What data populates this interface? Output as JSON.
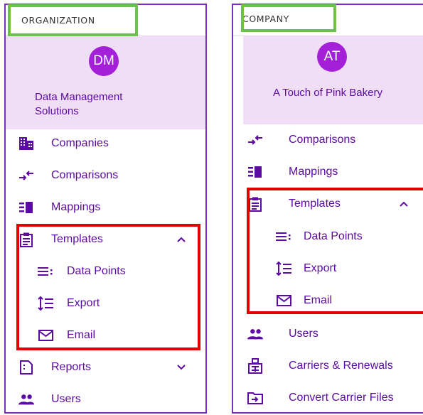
{
  "left_panel": {
    "section_label": "ORGANIZATION",
    "avatar_initials": "DM",
    "org_name": "Data Management Solutions",
    "menu": {
      "companies": "Companies",
      "comparisons": "Comparisons",
      "mappings": "Mappings",
      "templates": "Templates",
      "data_points": "Data Points",
      "export": "Export",
      "email": "Email",
      "reports": "Reports",
      "users": "Users"
    }
  },
  "right_panel": {
    "section_label": "COMPANY",
    "avatar_initials": "AT",
    "org_name": "A Touch of Pink Bakery",
    "menu": {
      "comparisons": "Comparisons",
      "mappings": "Mappings",
      "templates": "Templates",
      "data_points": "Data Points",
      "export": "Export",
      "email": "Email",
      "users": "Users",
      "carriers_renewals": "Carriers & Renewals",
      "convert_carrier_files": "Convert Carrier Files"
    }
  },
  "colors": {
    "brand_purple": "#5b0aa3",
    "avatar_bg": "#a320d8",
    "panel_border": "#7b2fc0",
    "org_box_bg": "#f0def7",
    "highlight_red": "#e00000",
    "highlight_green": "#6cc24a"
  },
  "icons": {
    "companies": "building-icon",
    "comparisons": "compare-arrows-icon",
    "mappings": "mapping-icon",
    "templates": "clipboard-icon",
    "data_points": "list-dots-icon",
    "export": "sort-export-icon",
    "email": "envelope-icon",
    "reports": "report-icon",
    "users": "people-icon",
    "carriers_renewals": "carrier-add-icon",
    "convert_carrier_files": "folder-arrow-icon",
    "expand_open": "chevron-up-icon",
    "expand_closed": "chevron-down-icon"
  }
}
